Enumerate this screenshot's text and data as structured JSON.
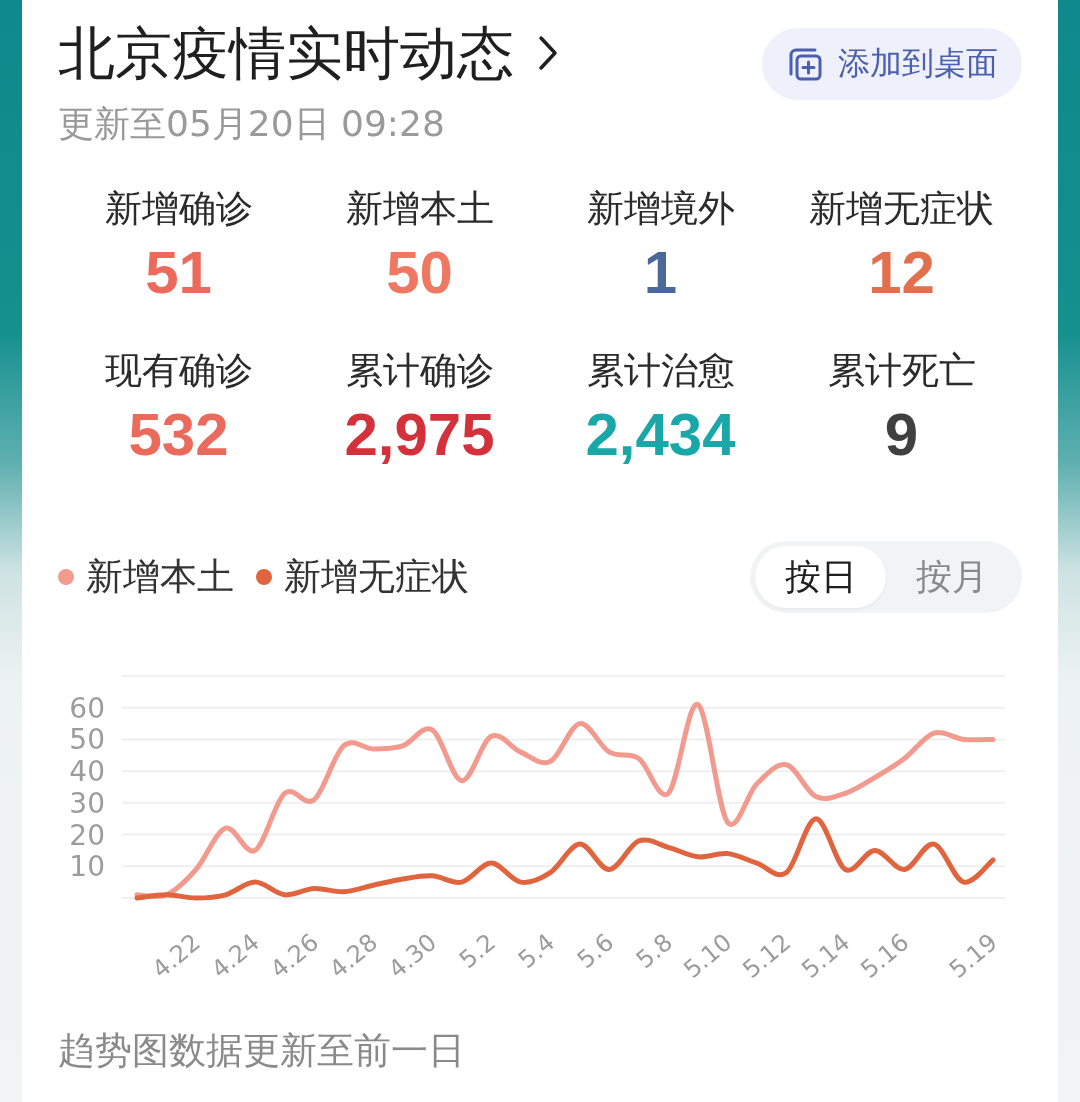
{
  "header": {
    "title": "北京疫情实时动态",
    "subtitle": "更新至05月20日 09:28",
    "add_button": {
      "label": "添加到桌面"
    }
  },
  "stats": [
    {
      "label": "新增确诊",
      "value": "51",
      "color": "#ec6a5c"
    },
    {
      "label": "新增本土",
      "value": "50",
      "color": "#ef7862"
    },
    {
      "label": "新增境外",
      "value": "1",
      "color": "#4a6898"
    },
    {
      "label": "新增无症状",
      "value": "12",
      "color": "#e2704e"
    },
    {
      "label": "现有确诊",
      "value": "532",
      "color": "#ea6a5c"
    },
    {
      "label": "累计确诊",
      "value": "2,975",
      "color": "#d3313b"
    },
    {
      "label": "累计治愈",
      "value": "2,434",
      "color": "#1aa7a7"
    },
    {
      "label": "累计死亡",
      "value": "9",
      "color": "#404040"
    }
  ],
  "trend": {
    "view_toggle": [
      {
        "label": "按日",
        "selected": true
      },
      {
        "label": "按月",
        "selected": false
      }
    ],
    "chart_data": {
      "type": "line",
      "grid": true,
      "categories": [
        null,
        null,
        "4.22",
        null,
        "4.24",
        null,
        "4.26",
        null,
        "4.28",
        null,
        "4.30",
        null,
        "5.2",
        null,
        "5.4",
        null,
        "5.6",
        null,
        "5.8",
        null,
        "5.10",
        null,
        "5.12",
        null,
        "5.14",
        null,
        "5.16",
        null,
        null,
        "5.19"
      ],
      "ylim": [
        0,
        70
      ],
      "yticks": [
        10,
        20,
        30,
        40,
        50,
        60
      ],
      "series": [
        {
          "name": "新增本土",
          "color": "#f29a8e",
          "values": [
            1,
            1,
            9,
            22,
            15,
            33,
            31,
            48,
            47,
            48,
            53,
            37,
            51,
            46,
            43,
            55,
            46,
            44,
            33,
            61,
            24,
            36,
            42,
            32,
            33,
            38,
            44,
            52,
            50,
            50
          ]
        },
        {
          "name": "新增无症状",
          "color": "#e0653f",
          "values": [
            0,
            1,
            0,
            1,
            5,
            1,
            3,
            2,
            4,
            6,
            7,
            5,
            11,
            5,
            8,
            17,
            9,
            18,
            16,
            13,
            14,
            11,
            8,
            25,
            9,
            15,
            9,
            17,
            5,
            12
          ]
        }
      ]
    },
    "note": "趋势图数据更新至前一日"
  }
}
